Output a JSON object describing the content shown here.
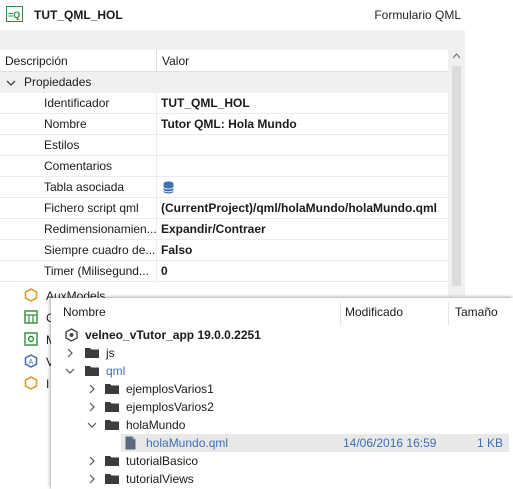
{
  "header": {
    "object_id": "TUT_QML_HOL",
    "object_type": "Formulario QML"
  },
  "grid": {
    "col_description": "Descripción",
    "col_value": "Valor",
    "group_label": "Propiedades",
    "rows": [
      {
        "key": "Identificador",
        "value": "TUT_QML_HOL"
      },
      {
        "key": "Nombre",
        "value": "Tutor QML: Hola Mundo"
      },
      {
        "key": "Estilos",
        "value": ""
      },
      {
        "key": "Comentarios",
        "value": ""
      },
      {
        "key": "Tabla asociada",
        "value": "",
        "icon": "database-icon"
      },
      {
        "key": "Fichero script qml",
        "value": "(CurrentProject)/qml/holaMundo/holaMundo.qml"
      },
      {
        "key": "Redimensionamien...",
        "value": "Expandir/Contraer"
      },
      {
        "key": "Siempre cuadro de...",
        "value": "Falso"
      },
      {
        "key": "Timer (Milisegund...",
        "value": "0"
      }
    ]
  },
  "side_items": [
    {
      "label": "AuxModels",
      "icon": "hexagon-icon"
    },
    {
      "label": "C",
      "icon": "table-icon"
    },
    {
      "label": "M",
      "icon": "gear-box-icon"
    },
    {
      "label": "V",
      "icon": "variable-icon"
    },
    {
      "label": "I",
      "icon": "hexagon-icon"
    }
  ],
  "explorer": {
    "columns": {
      "name": "Nombre",
      "modified": "Modificado",
      "size": "Tamaño"
    },
    "root": "velneo_vTutor_app 19.0.0.2251",
    "items": [
      {
        "label": "js",
        "depth": 1,
        "expanded": false,
        "type": "folder",
        "highlight": false
      },
      {
        "label": "qml",
        "depth": 1,
        "expanded": true,
        "type": "folder",
        "highlight": true
      },
      {
        "label": "ejemplosVarios1",
        "depth": 2,
        "expanded": false,
        "type": "folder",
        "highlight": false
      },
      {
        "label": "ejemplosVarios2",
        "depth": 2,
        "expanded": false,
        "type": "folder",
        "highlight": false
      },
      {
        "label": "holaMundo",
        "depth": 2,
        "expanded": true,
        "type": "folder",
        "highlight": false
      },
      {
        "label": "holaMundo.qml",
        "depth": 3,
        "type": "file",
        "modified": "14/06/2016 16:59",
        "size": "1 KB",
        "selected": true
      },
      {
        "label": "tutorialBasico",
        "depth": 2,
        "expanded": false,
        "type": "folder",
        "highlight": false
      },
      {
        "label": "tutorialViews",
        "depth": 2,
        "expanded": false,
        "type": "folder",
        "highlight": false
      }
    ]
  },
  "colors": {
    "accent": "#3b6fb5",
    "folder": "#3c3c3c",
    "icon_green": "#2e8b3a",
    "icon_orange": "#e39a2d"
  }
}
